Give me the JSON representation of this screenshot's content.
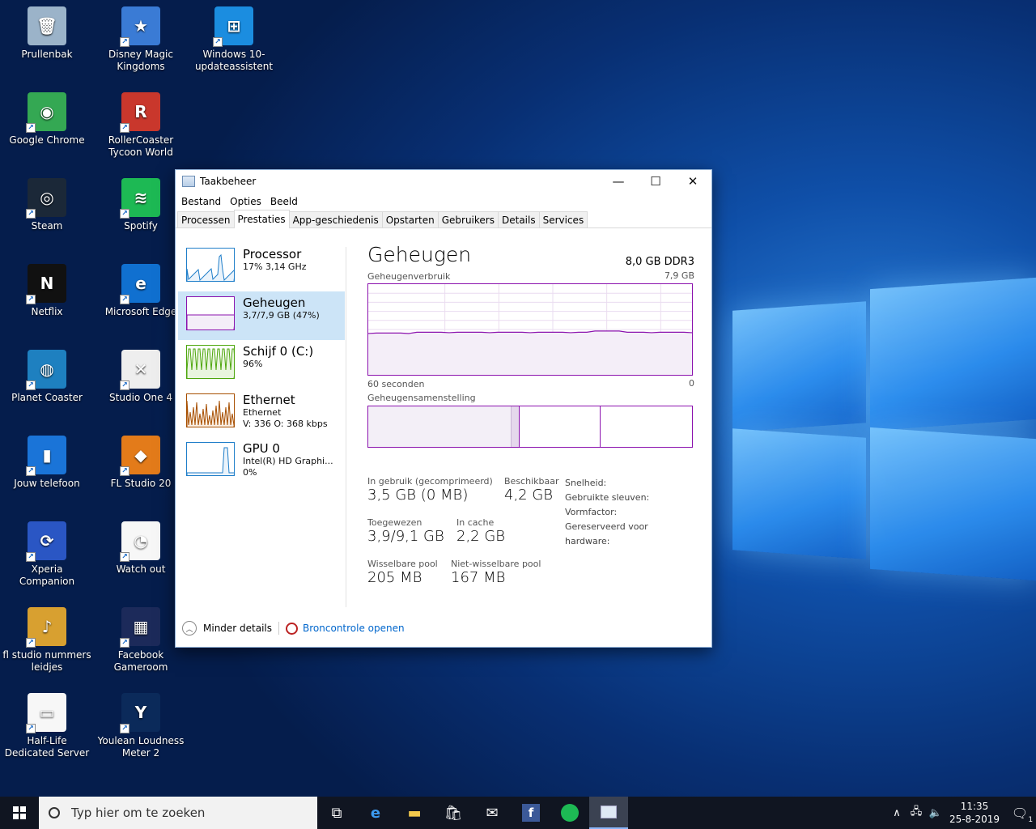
{
  "desktop": {
    "icons": [
      {
        "label": "Prullenbak",
        "color": "#9bb3c9"
      },
      {
        "label": "Disney Magic Kingdoms",
        "color": "#3a7bd5"
      },
      {
        "label": "Windows 10-updateassistent",
        "color": "#1b8de0"
      },
      {
        "label": "Google Chrome",
        "color": "#34a853"
      },
      {
        "label": "RollerCoaster Tycoon World",
        "color": "#c9372c"
      },
      {
        "label": "Steam",
        "color": "#1b2838"
      },
      {
        "label": "Spotify",
        "color": "#1db954"
      },
      {
        "label": "Netflix",
        "color": "#111111"
      },
      {
        "label": "Microsoft Edge",
        "color": "#1070d0"
      },
      {
        "label": "Planet Coaster",
        "color": "#1e80c0"
      },
      {
        "label": "Studio One 4",
        "color": "#eeeeee"
      },
      {
        "label": "Jouw telefoon",
        "color": "#1a74d8"
      },
      {
        "label": "FL Studio 20",
        "color": "#e37b1a"
      },
      {
        "label": "Xperia Companion",
        "color": "#2a56c4"
      },
      {
        "label": "Watch out",
        "color": "#f7f7f7"
      },
      {
        "label": "fl studio nummers leidjes",
        "color": "#d8a030"
      },
      {
        "label": "Facebook Gameroom",
        "color": "#1c2a5a"
      },
      {
        "label": "Half-Life Dedicated Server",
        "color": "#f7f7f7"
      },
      {
        "label": "Youlean Loudness Meter 2",
        "color": "#0b2a5a"
      }
    ]
  },
  "taskmanager": {
    "title": "Taakbeheer",
    "controls": {
      "minimize": "—",
      "maximize": "☐",
      "close": "✕"
    },
    "menu": [
      "Bestand",
      "Opties",
      "Beeld"
    ],
    "tabs": [
      "Processen",
      "Prestaties",
      "App-geschiedenis",
      "Opstarten",
      "Gebruikers",
      "Details",
      "Services"
    ],
    "resources": [
      {
        "name": "Processor",
        "sub1": "17%  3,14 GHz",
        "sub2": "",
        "color": "#1f7ec9"
      },
      {
        "name": "Geheugen",
        "sub1": "3,7/7,9 GB (47%)",
        "sub2": "",
        "color": "#8b12ae"
      },
      {
        "name": "Schijf 0 (C:)",
        "sub1": "96%",
        "sub2": "",
        "color": "#4da60c"
      },
      {
        "name": "Ethernet",
        "sub1": "Ethernet",
        "sub2": "V: 336  O: 368 kbps",
        "color": "#a74f01"
      },
      {
        "name": "GPU 0",
        "sub1": "Intel(R) HD Graphi...",
        "sub2": "0%",
        "color": "#1f7ec9"
      }
    ],
    "detail": {
      "title": "Geheugen",
      "spec": "8,0 GB DDR3",
      "graph_label": "Geheugenverbruik",
      "graph_max": "7,9 GB",
      "graph_time": "60 seconden",
      "graph_min": "0",
      "comp_label": "Geheugensamenstelling",
      "usage_fraction": 0.47,
      "stats": {
        "in_use_label": "In gebruik (gecomprimeerd)",
        "in_use": "3,5 GB (0 MB)",
        "avail_label": "Beschikbaar",
        "avail": "4,2 GB",
        "commit_label": "Toegewezen",
        "commit": "3,9/9,1 GB",
        "cache_label": "In cache",
        "cache": "2,2 GB",
        "paged_label": "Wisselbare pool",
        "paged": "205 MB",
        "nonpaged_label": "Niet-wisselbare pool",
        "nonpaged": "167 MB"
      },
      "props": [
        "Snelheid:",
        "Gebruikte sleuven:",
        "Vormfactor:",
        "Gereserveerd voor hardware:"
      ]
    },
    "footer": {
      "less": "Minder details",
      "monitor": "Broncontrole openen"
    }
  },
  "taskbar": {
    "search_placeholder": "Typ hier om te zoeken",
    "time": "11:35",
    "date": "25-8-2019",
    "notifications": "1"
  }
}
